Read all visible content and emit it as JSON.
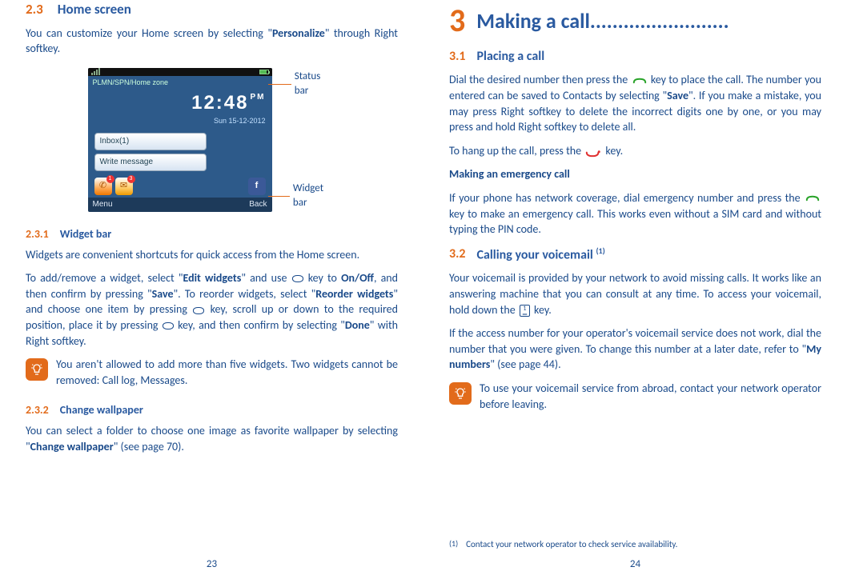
{
  "left": {
    "sec23_num": "2.3",
    "sec23_title": "Home screen",
    "intro_a": "You can customize your Home screen by selecting \"",
    "intro_b": "Personalize",
    "intro_c": "\" through Right softkey.",
    "callout_status": "Status bar",
    "callout_widget": "Widget bar",
    "phone": {
      "zone": "PLMN/SPN/Home zone",
      "time": "12:48",
      "pm": "PM",
      "date": "Sun 15-12-2012",
      "inbox": "Inbox(1)",
      "write": "Write message",
      "badge1": "1",
      "badge3": "3",
      "fb": "f",
      "sk_left": "Menu",
      "sk_right": "Back"
    },
    "sec231_num": "2.3.1",
    "sec231_title": "Widget bar",
    "p1": "Widgets are convenient shortcuts for quick access from the Home screen.",
    "p2_a": "To add/remove a widget, select \"",
    "p2_b": "Edit widgets",
    "p2_c": "\" and use ",
    "p2_d": " key to ",
    "p2_e": "On/Off",
    "p2_f": ", and then confirm by pressing \"",
    "p2_g": "Save",
    "p2_h": "\". To reorder widgets, select \"",
    "p2_i": "Reorder widgets",
    "p2_j": "\" and choose one item by pressing ",
    "p2_k": " key, scroll up or down to the required position, place it by pressing ",
    "p2_l": " key, and then confirm by selecting \"",
    "p2_m": "Done",
    "p2_n": "\" with Right softkey.",
    "note1": "You aren't allowed to add more than five widgets. Two widgets cannot be removed: Call log, Messages.",
    "sec232_num": "2.3.2",
    "sec232_title": "Change wallpaper",
    "p3_a": "You can select a folder to choose one image as favorite wallpaper by selecting \"",
    "p3_b": "Change wallpaper",
    "p3_c": "\" (see page 70).",
    "pagenum": "23"
  },
  "right": {
    "chapter_num": "3",
    "chapter_title": "Making a call.........................",
    "sec31_num": "3.1",
    "sec31_title": "Placing a call",
    "p1_a": "Dial the desired number then press the ",
    "p1_b": " key to place the call. The number you entered can be saved to Contacts by selecting \"",
    "p1_c": "Save",
    "p1_d": "\".  If you make a mistake, you may press Right softkey to delete the incorrect digits one by one, or you may press and hold Right softkey to delete all.",
    "p2_a": "To hang up the call, press the ",
    "p2_b": " key.",
    "h_emerg": "Making an emergency call",
    "p3_a": "If your phone has network coverage, dial emergency number and press the ",
    "p3_b": " key to make an emergency call. This works even without a SIM card and without typing the PIN code.",
    "sec32_num": "3.2",
    "sec32_title_a": "Calling your voicemail ",
    "sec32_sup": "(1)",
    "p4_a": "Your voicemail is provided by your network to avoid missing calls. It works like an answering machine that you can consult at any time. To access your voicemail, hold down the ",
    "p4_b": " key.",
    "p5_a": "If the access number for your operator's voicemail service does not work, dial the number that you were given. To change this number at a later date, refer to \"",
    "p5_b": "My numbers",
    "p5_c": "\" (see page 44).",
    "note2": "To use your voicemail service from abroad, contact your network operator before leaving.",
    "fn_mark": "(1)",
    "fn_text": "Contact your network operator to check service availability.",
    "pagenum": "24"
  }
}
